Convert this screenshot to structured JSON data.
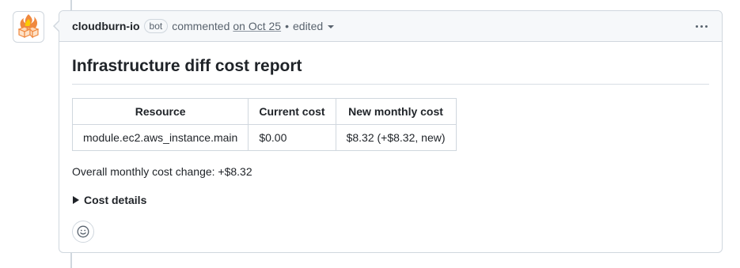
{
  "comment": {
    "author": "cloudburn-io",
    "badge": "bot",
    "action": "commented",
    "timestamp": "on Oct 25",
    "separator": "•",
    "edited_label": "edited"
  },
  "report": {
    "title": "Infrastructure diff cost report",
    "table": {
      "headers": [
        "Resource",
        "Current cost",
        "New monthly cost"
      ],
      "rows": [
        [
          "module.ec2.aws_instance.main",
          "$0.00",
          "$8.32 (+$8.32, new)"
        ]
      ]
    },
    "summary": "Overall monthly cost change: +$8.32",
    "details_label": "Cost details"
  },
  "icons": {
    "avatar": "cloudburn-logo",
    "menu": "kebab-icon",
    "reaction": "smiley-icon",
    "details": "disclosure-triangle-icon"
  },
  "colors": {
    "border": "#d0d7de",
    "header_bg": "#f6f8fa",
    "text": "#1f2328",
    "muted": "#59636e"
  }
}
